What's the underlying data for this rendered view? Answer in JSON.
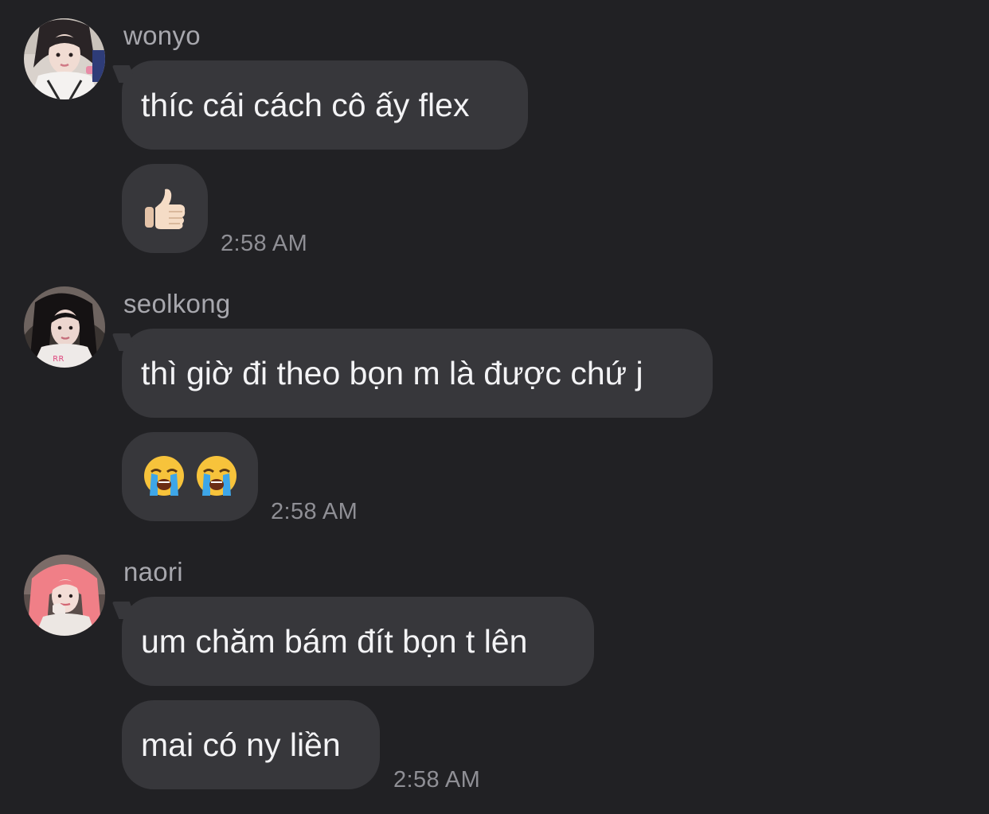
{
  "messages": [
    {
      "sender": "wonyo",
      "bubbles": [
        "thíc cái cách cô ấy flex"
      ],
      "emoji": [
        "thumbs-up-icon"
      ],
      "time": "2:58 AM"
    },
    {
      "sender": "seolkong",
      "bubbles": [
        "thì giờ đi theo bọn m là được chứ j"
      ],
      "emoji": [
        "crying-face-icon",
        "crying-face-icon"
      ],
      "time": "2:58 AM"
    },
    {
      "sender": "naori",
      "bubbles": [
        "um chăm bám đít bọn t lên",
        "mai có ny liền"
      ],
      "time": "2:58 AM"
    }
  ]
}
